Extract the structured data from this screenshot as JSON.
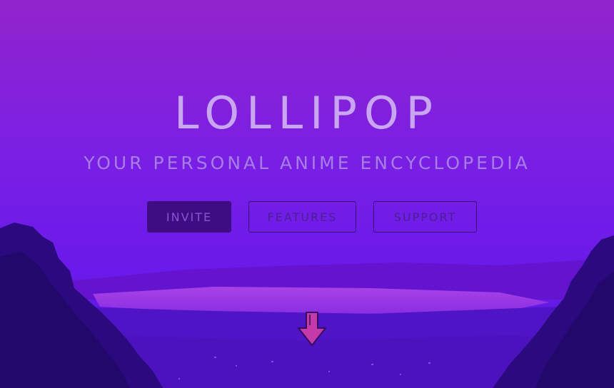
{
  "hero": {
    "title": "LOLLIPOP",
    "subtitle": "YOUR PERSONAL ANIME ENCYCLOPEDIA"
  },
  "buttons": {
    "invite": "INVITE",
    "features": "FEATURES",
    "support": "SUPPORT"
  },
  "icons": {
    "scroll": "arrow-down-icon"
  },
  "colors": {
    "background": "#7b1ee6",
    "title": "#c9a6f2",
    "subtitle": "#a77ee6",
    "invite_fill": "#3e0d84",
    "arrow": "#c43aa8"
  }
}
